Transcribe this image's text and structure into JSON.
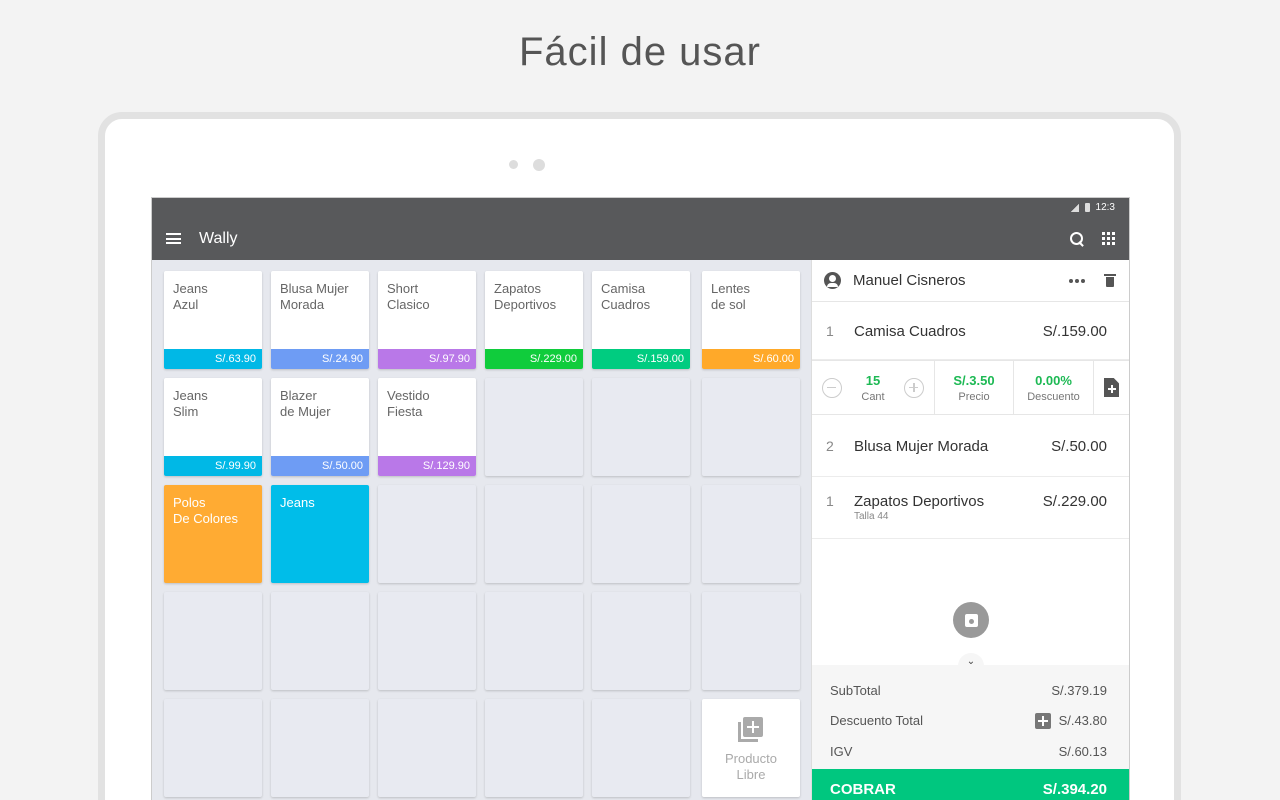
{
  "headline": "Fácil de usar",
  "status": {
    "time": "12:3"
  },
  "appbar": {
    "title": "Wally"
  },
  "products": [
    {
      "name": "Jeans\nAzul",
      "price": "S/.63.90",
      "color": "#00b8e6"
    },
    {
      "name": "Blusa Mujer\nMorada",
      "price": "S/.24.90",
      "color": "#6e9cf4"
    },
    {
      "name": "Short\nClasico",
      "price": "S/.97.90",
      "color": "#b978e8"
    },
    {
      "name": "Zapatos\nDeportivos",
      "price": "S/.229.00",
      "color": "#10cc3c"
    },
    {
      "name": "Camisa\nCuadros",
      "price": "S/.159.00",
      "color": "#00cc80"
    },
    {
      "name": "Lentes\nde sol",
      "price": "S/.60.00",
      "color": "#ffa929"
    },
    {
      "name": "Jeans\nSlim",
      "price": "S/.99.90",
      "color": "#00b8e6"
    },
    {
      "name": "Blazer\nde Mujer",
      "price": "S/.50.00",
      "color": "#6e9cf4"
    },
    {
      "name": "Vestido\nFiesta",
      "price": "S/.129.90",
      "color": "#b978e8"
    }
  ],
  "categories": [
    {
      "name": "Polos\nDe Colores",
      "color": "#ffab33"
    },
    {
      "name": "Jeans",
      "color": "#00bde9"
    }
  ],
  "libre": {
    "label": "Producto\nLibre"
  },
  "cart": {
    "customer": "Manuel Cisneros",
    "items": [
      {
        "qty": "1",
        "name": "Camisa Cuadros",
        "price": "S/.159.00",
        "sub": ""
      },
      {
        "qty": "2",
        "name": "Blusa Mujer Morada",
        "price": "S/.50.00",
        "sub": ""
      },
      {
        "qty": "1",
        "name": "Zapatos Deportivos",
        "price": "S/.229.00",
        "sub": "Talla 44"
      }
    ],
    "editor": {
      "cant_value": "15",
      "cant_label": "Cant",
      "precio_value": "S/.3.50",
      "precio_label": "Precio",
      "descuento_value": "0.00%",
      "descuento_label": "Descuento"
    },
    "totals": {
      "subtotal_label": "SubTotal",
      "subtotal_value": "S/.379.19",
      "descuento_label": "Descuento Total",
      "descuento_value": "S/.43.80",
      "igv_label": "IGV",
      "igv_value": "S/.60.13"
    },
    "cobrar": {
      "label": "COBRAR",
      "value": "S/.394.20"
    }
  }
}
